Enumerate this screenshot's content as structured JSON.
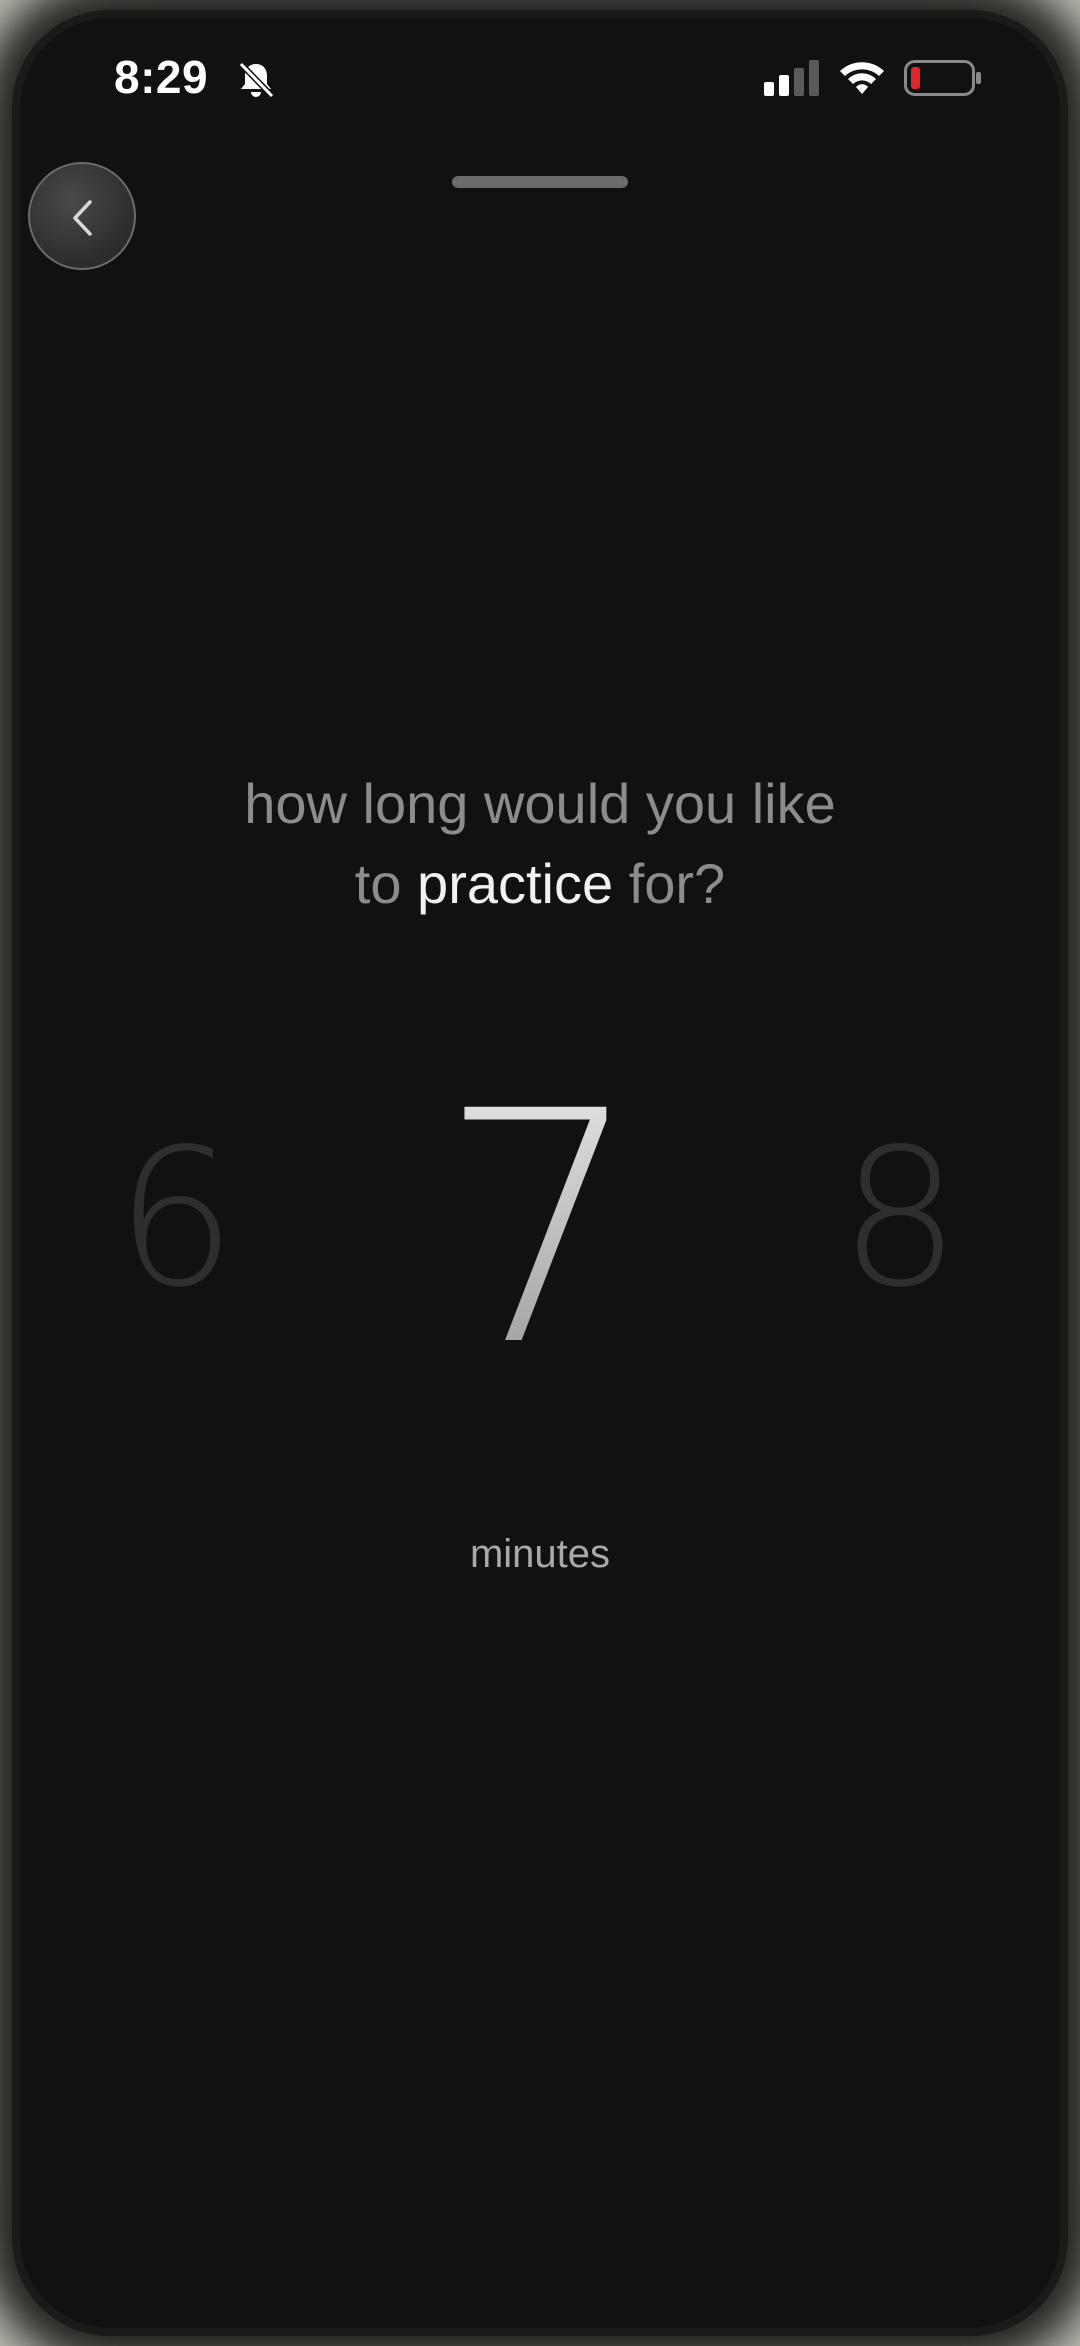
{
  "status_bar": {
    "time": "8:29",
    "icons": [
      "bell-slash-icon",
      "cellular-signal-icon",
      "wifi-icon",
      "battery-low-icon"
    ]
  },
  "back_button": {
    "icon": "chevron-left-icon"
  },
  "prompt": {
    "line1": "how long would you like",
    "line2_pre": "to",
    "line2_highlight": "practice",
    "line2_post": "for?"
  },
  "picker": {
    "previous": "6",
    "current": "7",
    "next": "8",
    "unit": "minutes"
  },
  "colors": {
    "background": "#111111",
    "text_dim": "#8c8c8c",
    "text_highlight": "#f2f2f2",
    "battery_low": "#e0282b"
  }
}
